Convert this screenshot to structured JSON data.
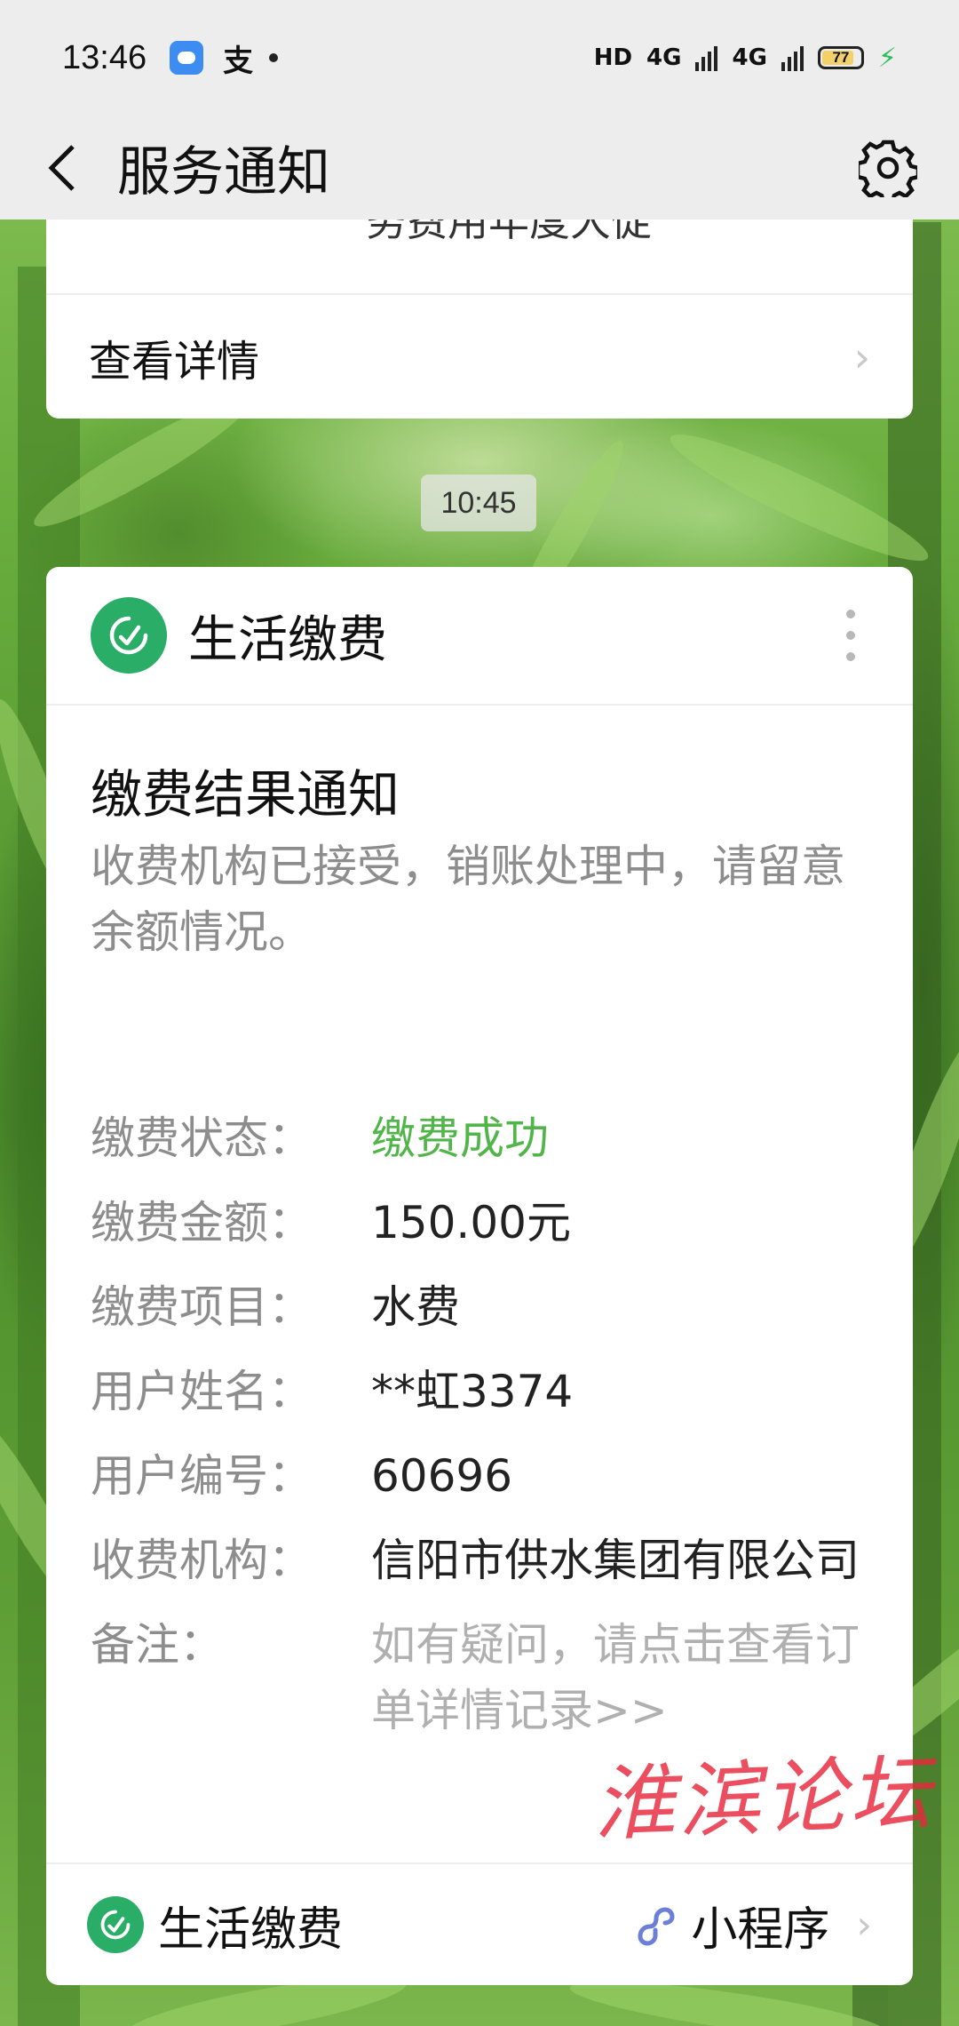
{
  "status_bar": {
    "time": "13:46",
    "alipay_glyph": "支",
    "hd_label": "HD",
    "net1": "4G",
    "net2": "4G",
    "battery": "77"
  },
  "nav": {
    "title": "服务通知"
  },
  "prev_card": {
    "clipped_text": "务费用年度大促",
    "detail_label": "查看详情"
  },
  "timestamp": "10:45",
  "card": {
    "source": "生活缴费",
    "title": "缴费结果通知",
    "description": "收费机构已接受，销账处理中，请留意余额情况。",
    "fields": [
      {
        "label": "缴费状态：",
        "value": "缴费成功"
      },
      {
        "label": "缴费金额：",
        "value": "150.00元"
      },
      {
        "label": "缴费项目：",
        "value": "水费"
      },
      {
        "label": "用户姓名：",
        "value": "**虹3374"
      },
      {
        "label": "用户编号：",
        "value": "60696"
      },
      {
        "label": "收费机构：",
        "value": "信阳市供水集团有限公司"
      },
      {
        "label": "备注：",
        "value": "如有疑问，请点击查看订单详情记录>>"
      }
    ],
    "footer_source": "生活缴费",
    "footer_type": "小程序"
  },
  "watermark": "淮滨论坛",
  "colors": {
    "brand_green": "#2aae67",
    "success_green": "#52b54a",
    "watermark_red": "#e6283c"
  }
}
